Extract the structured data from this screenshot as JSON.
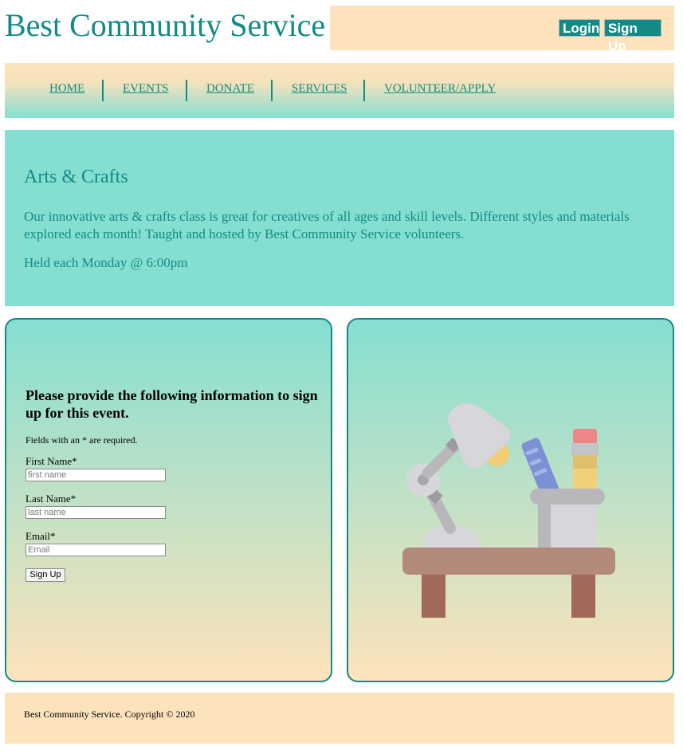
{
  "header": {
    "site_title": "Best Community Service",
    "login_label": "Login",
    "signup_label": "Sign Up"
  },
  "nav": {
    "items": [
      {
        "label": "HOME"
      },
      {
        "label": "EVENTS"
      },
      {
        "label": "DONATE"
      },
      {
        "label": "SERVICES"
      },
      {
        "label": "VOLUNTEER/APPLY"
      }
    ]
  },
  "hero": {
    "title": "Arts & Crafts",
    "description": "Our innovative arts & crafts class is great for creatives of all ages and skill levels. Different styles and materials explored each month! Taught and hosted by Best Community Service volunteers.",
    "schedule": "Held each Monday @ 6:00pm"
  },
  "form": {
    "heading": "Please provide the following information to sign up for this event.",
    "required_note": "Fields with an * are required.",
    "first_name": {
      "label": "First Name*",
      "placeholder": "first name",
      "value": ""
    },
    "last_name": {
      "label": "Last Name*",
      "placeholder": "last name",
      "value": ""
    },
    "email": {
      "label": "Email*",
      "placeholder": "Email",
      "value": ""
    },
    "submit_label": "Sign Up"
  },
  "illustration": {
    "icon": "desk-lamp-pencil-cup-icon"
  },
  "footer": {
    "copyright": "Best Community Service. Copyright © 2020"
  },
  "colors": {
    "brand_teal": "#128a86",
    "mint": "#85dfd1",
    "peach": "#fde3bb"
  }
}
